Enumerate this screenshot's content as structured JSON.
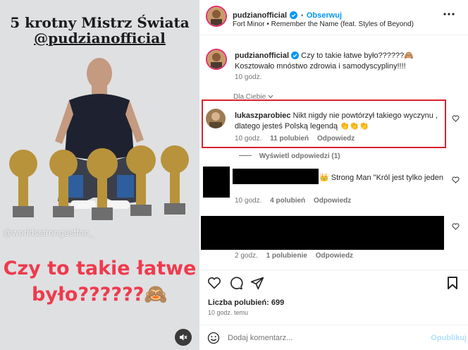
{
  "media": {
    "headline_line1": "5 krotny Mistrz Świata",
    "headline_line2": "@pudzianofficial",
    "watermark": "@worldsstrongestfan_",
    "caption_line1": "Czy to takie łatwe",
    "caption_line2": "było??????🙈"
  },
  "header": {
    "username": "pudzianofficial",
    "separator": "•",
    "follow_label": "Obserwuj",
    "audio": "Fort Minor • Remember the Name (feat. Styles of Beyond)"
  },
  "caption": {
    "username": "pudzianofficial",
    "line1": "Czy to takie łatwe było??????🙈",
    "line2": "Kosztowało mnóstwo zdrowia i samodyscypliny!!!!",
    "time": "10 godz."
  },
  "sort_label": "Dla Ciebie",
  "comments": [
    {
      "username": "lukaszparobiec",
      "line1": "Nikt nigdy nie powtórzył takiego wyczynu ,",
      "line2": "dlatego jesteś Polską legendą 👏👏👏",
      "time": "10 godz.",
      "likes": "11 polubień",
      "reply_label": "Odpowiedz",
      "view_replies": "Wyświetl odpowiedzi (1)"
    },
    {
      "text_visible": "👑 Strong Man \"Król jest tylko jeden",
      "time": "10 godz.",
      "likes": "4 polubień",
      "reply_label": "Odpowiedz"
    },
    {
      "time": "2 godz.",
      "likes": "1 polubienie",
      "reply_label": "Odpowiedz"
    }
  ],
  "likes_summary": "Liczba polubień: 699",
  "post_time": "10 godz. temu",
  "comment_input": {
    "placeholder": "Dodaj komentarz..."
  },
  "publish_label": "Opublikuj",
  "colors": {
    "accent": "#0095f6",
    "highlight": "#d9232e",
    "caption_red": "#ef3a4d"
  },
  "icons": [
    "more-icon",
    "heart-icon",
    "comment-icon",
    "share-icon",
    "bookmark-icon",
    "emoji-icon",
    "mute-icon",
    "verified-icon",
    "chevron-down-icon"
  ]
}
